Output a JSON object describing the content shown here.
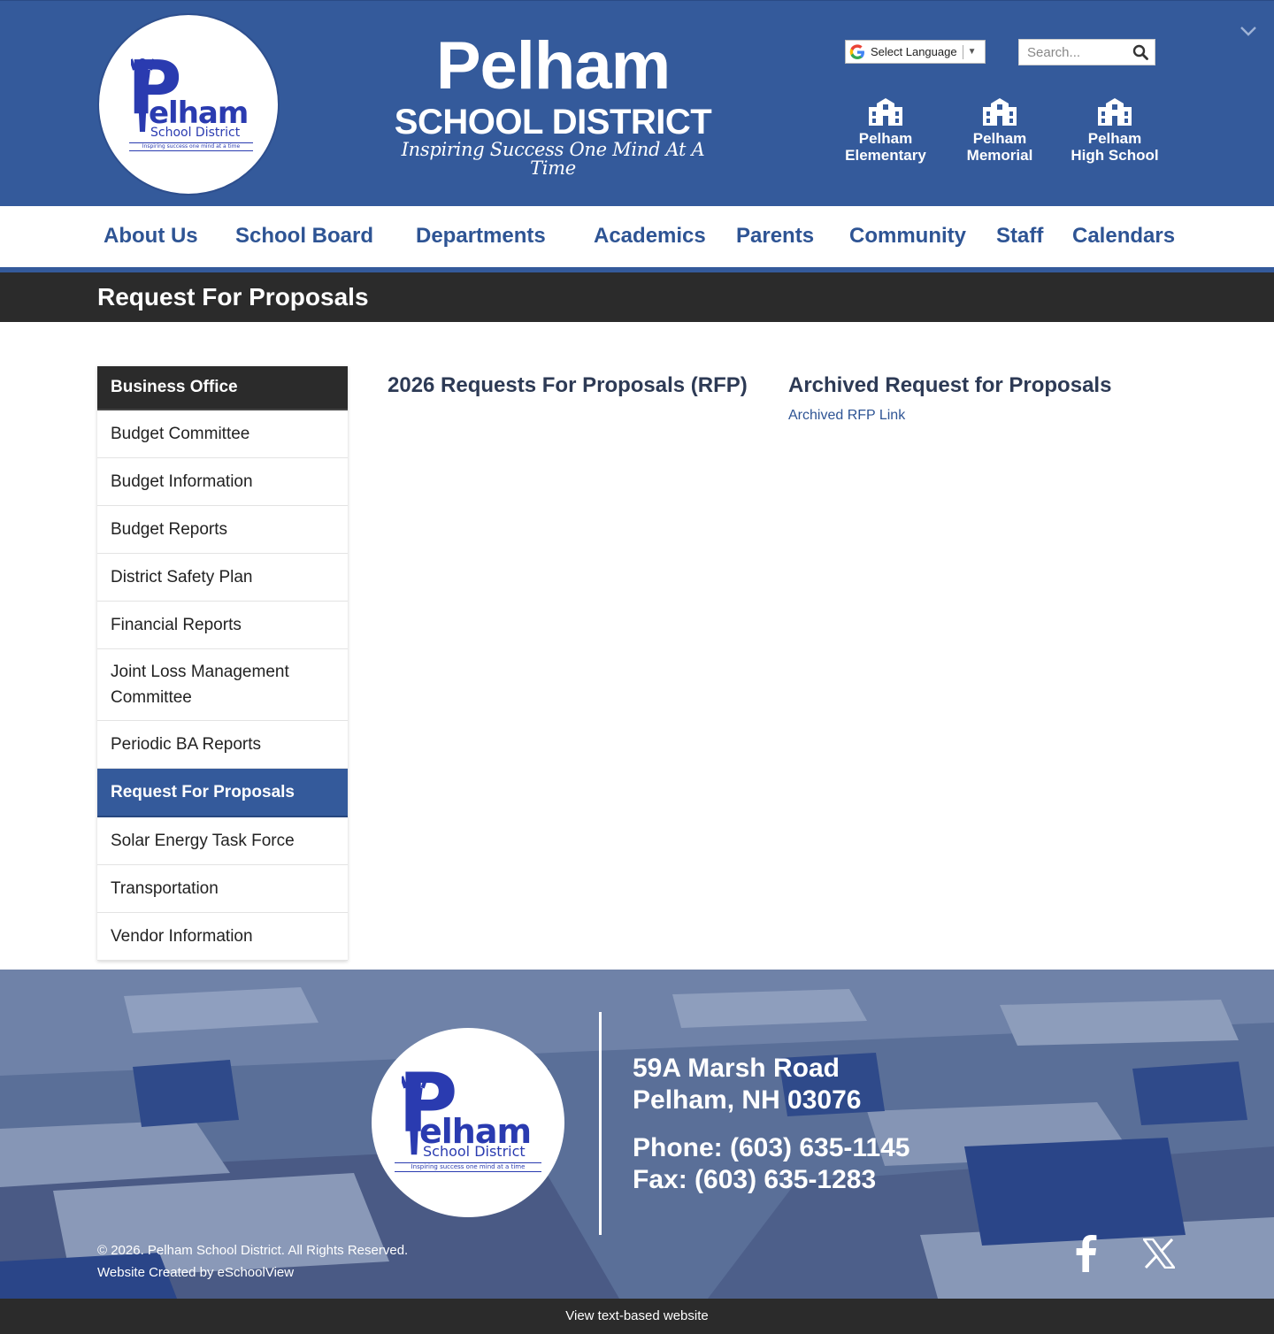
{
  "header": {
    "logo": {
      "letter": "P",
      "word": "elham",
      "sub": "School District",
      "tagline": "Inspiring success one mind at a time"
    },
    "brand_title": "Pelham",
    "brand_subtitle": "SCHOOL DISTRICT",
    "brand_tagline": "Inspiring Success One Mind At A Time",
    "language_select": "Select Language",
    "search_placeholder": "Search...",
    "schools": [
      {
        "line1": "Pelham",
        "line2": "Elementary"
      },
      {
        "line1": "Pelham",
        "line2": "Memorial"
      },
      {
        "line1": "Pelham",
        "line2": "High School"
      }
    ]
  },
  "nav": {
    "items": [
      "About Us",
      "School Board",
      "Departments",
      "Academics",
      "Parents",
      "Community",
      "Staff",
      "Calendars"
    ]
  },
  "page_title": "Request For Proposals",
  "sidebar": {
    "heading": "Business Office",
    "items": [
      "Budget Committee",
      "Budget Information",
      "Budget Reports",
      "District Safety Plan",
      "Financial Reports",
      "Joint Loss Management Committee",
      "Periodic BA Reports",
      "Request For Proposals",
      "Solar Energy Task Force",
      "Transportation",
      "Vendor Information"
    ],
    "active_item": "Request For Proposals"
  },
  "content": {
    "col1_title": "2026 Requests For Proposals (RFP)",
    "col2_title": "Archived Request for Proposals",
    "archived_link": "Archived RFP Link"
  },
  "footer": {
    "address_line1": "59A Marsh Road",
    "address_line2": "Pelham, NH 03076",
    "phone": "Phone: (603) 635-1145",
    "fax": "Fax: (603) 635-1283",
    "copyright": "© 2026. Pelham School District. All Rights Reserved.",
    "credit": "Website Created by eSchoolView",
    "social": [
      "facebook-icon",
      "x-icon"
    ]
  },
  "bottom_bar": {
    "text_link": "View text-based website"
  },
  "colors": {
    "brand_blue": "#345a9b",
    "nav_text": "#2e5494",
    "dark_bar": "#2b2b2b",
    "logo_blue": "#2a3bb0"
  }
}
